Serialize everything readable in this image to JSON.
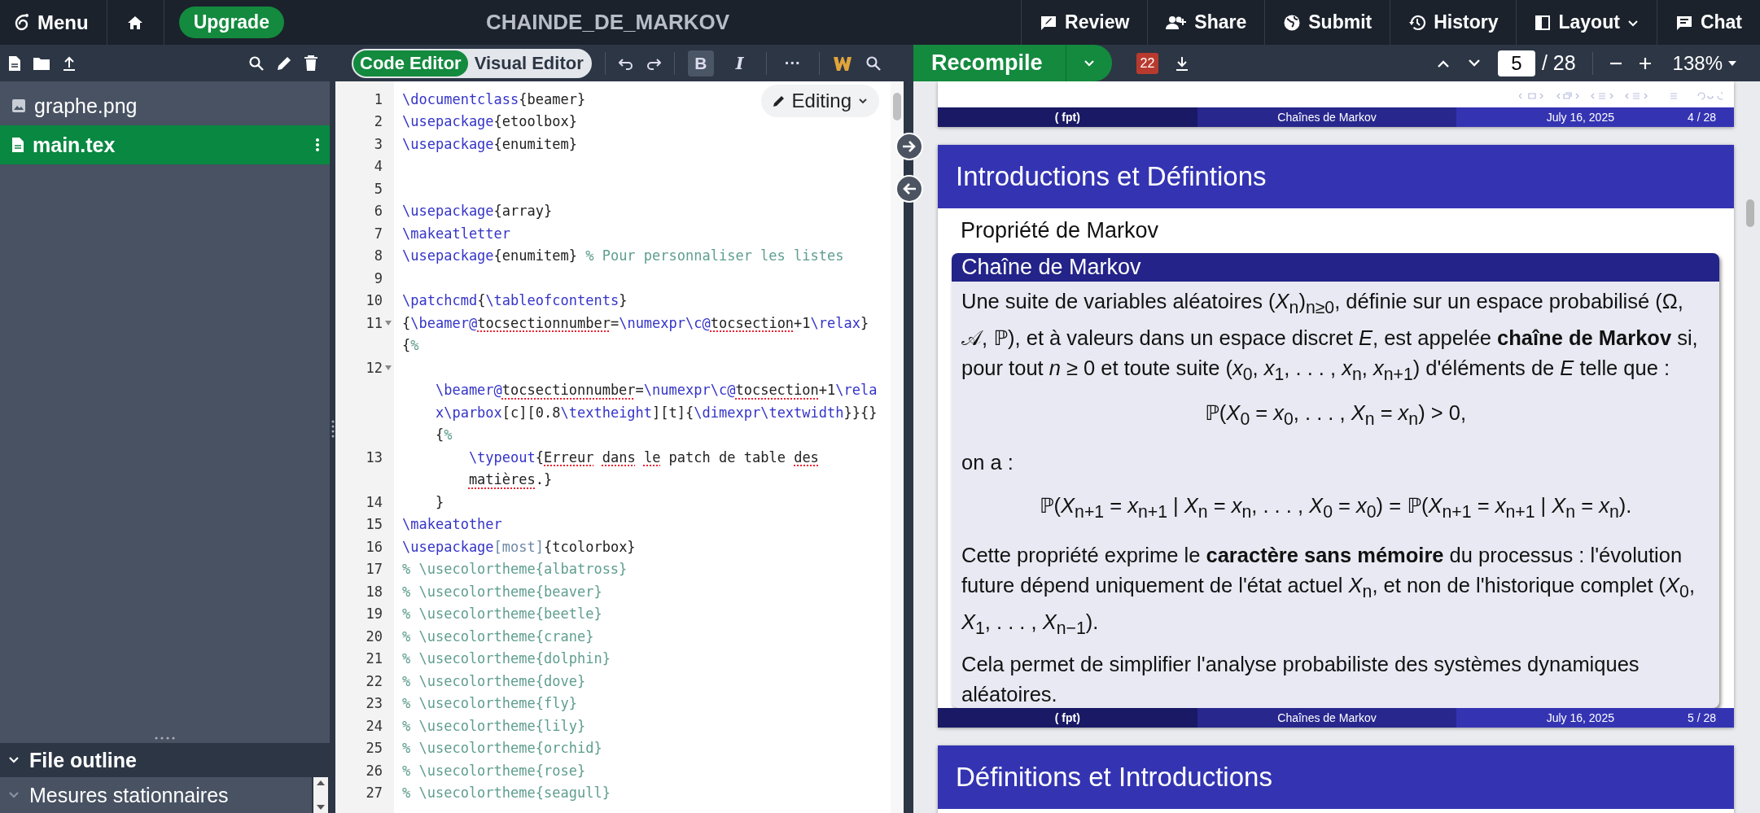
{
  "top_bar": {
    "menu_label": "Menu",
    "upgrade_label": "Upgrade",
    "title": "CHAINDE_DE_MARKOV",
    "actions": [
      {
        "kind": "review",
        "label": "Review"
      },
      {
        "kind": "share",
        "label": "Share"
      },
      {
        "kind": "submit",
        "label": "Submit"
      },
      {
        "kind": "history",
        "label": "History"
      },
      {
        "kind": "layout",
        "label": "Layout"
      },
      {
        "kind": "chat",
        "label": "Chat"
      }
    ]
  },
  "file_tree": {
    "files": [
      {
        "kind": "image",
        "name": "graphe.png",
        "selected": false
      },
      {
        "kind": "tex",
        "name": "main.tex",
        "selected": true
      }
    ]
  },
  "file_outline": {
    "title": "File outline",
    "expanded": true,
    "items": [
      {
        "label": "Mesures stationnaires"
      }
    ]
  },
  "editor_toolbar": {
    "modes": [
      {
        "label": "Code Editor",
        "selected": true
      },
      {
        "label": "Visual Editor",
        "selected": false
      }
    ],
    "format_buttons": [
      {
        "kind": "bold",
        "label": "B",
        "active": true
      },
      {
        "kind": "italic",
        "label": "I",
        "active": false
      }
    ],
    "more_label": "···"
  },
  "editing_menu": {
    "label": "Editing"
  },
  "code_lines": [
    {
      "number": "1",
      "segments": [
        {
          "kind": "command",
          "text": "\\documentclass"
        },
        {
          "kind": "text",
          "text": "{beamer}"
        }
      ]
    },
    {
      "number": "2",
      "segments": [
        {
          "kind": "command",
          "text": "\\usepackage"
        },
        {
          "kind": "text",
          "text": "{etoolbox}"
        }
      ]
    },
    {
      "number": "3",
      "segments": [
        {
          "kind": "command",
          "text": "\\usepackage"
        },
        {
          "kind": "text",
          "text": "{enumitem}"
        }
      ]
    },
    {
      "number": "4"
    },
    {
      "number": "5"
    },
    {
      "number": "6",
      "segments": [
        {
          "kind": "command",
          "text": "\\usepackage"
        },
        {
          "kind": "text",
          "text": "{array}"
        }
      ]
    },
    {
      "number": "7",
      "segments": [
        {
          "kind": "command",
          "text": "\\makeatletter"
        }
      ]
    },
    {
      "number": "8",
      "segments": [
        {
          "kind": "command",
          "text": "\\usepackage"
        },
        {
          "kind": "text",
          "text": "{enumitem} "
        },
        {
          "kind": "comment",
          "text": "% Pour personnaliser les listes"
        }
      ]
    },
    {
      "number": "9"
    },
    {
      "number": "10",
      "segments": [
        {
          "kind": "command",
          "text": "\\patchcmd"
        },
        {
          "kind": "text",
          "text": "{"
        },
        {
          "kind": "command",
          "text": "\\tableofcontents"
        },
        {
          "kind": "text",
          "text": "}"
        }
      ]
    },
    {
      "number": "11",
      "fold": true,
      "segments": [
        {
          "kind": "text",
          "text": "{"
        },
        {
          "kind": "command",
          "text": "\\beamer@"
        },
        {
          "kind": "typo",
          "text": "tocsectionnumber"
        },
        {
          "kind": "text",
          "text": "="
        },
        {
          "kind": "command",
          "text": "\\numexpr\\c@"
        },
        {
          "kind": "typo",
          "text": "tocsection"
        },
        {
          "kind": "text",
          "text": "+1"
        },
        {
          "kind": "command",
          "text": "\\relax"
        },
        {
          "kind": "text",
          "text": "}"
        }
      ]
    },
    {
      "segments": [
        {
          "kind": "text",
          "text": "{"
        },
        {
          "kind": "comment",
          "text": "%"
        }
      ]
    },
    {
      "number": "12",
      "fold": true,
      "children": [
        {
          "segments": [
            {
              "kind": "command",
              "text": "\\beamer@"
            },
            {
              "kind": "typo",
              "text": "tocsectionnumber"
            },
            {
              "kind": "text",
              "text": "="
            },
            {
              "kind": "command",
              "text": "\\numexpr\\c@"
            },
            {
              "kind": "typo",
              "text": "tocsection"
            },
            {
              "kind": "text",
              "text": "+1"
            },
            {
              "kind": "command",
              "text": "\\rela"
            }
          ]
        },
        {
          "segments": [
            {
              "kind": "command",
              "text": "x\\parbox"
            },
            {
              "kind": "text",
              "text": "[c][0.8"
            },
            {
              "kind": "command",
              "text": "\\textheight"
            },
            {
              "kind": "text",
              "text": "][t]{"
            },
            {
              "kind": "command",
              "text": "\\dimexpr"
            },
            {
              "kind": "command",
              "text": "\\textwidth"
            },
            {
              "kind": "text",
              "text": "}}{}"
            }
          ]
        },
        {
          "segments": [
            {
              "kind": "text",
              "text": "{"
            },
            {
              "kind": "comment",
              "text": "%"
            }
          ],
          "children": [
            {
              "number": "13",
              "segments": [
                {
                  "kind": "command",
                  "text": "\\typeout"
                },
                {
                  "kind": "text",
                  "text": "{"
                },
                {
                  "kind": "typo",
                  "text": "Erreur dans le"
                },
                {
                  "kind": "text",
                  "text": " patch de table "
                },
                {
                  "kind": "typo",
                  "text": "des"
                }
              ]
            },
            {
              "segments": [
                {
                  "kind": "typo",
                  "text": "matières"
                },
                {
                  "kind": "text",
                  "text": ".}"
                }
              ]
            }
          ]
        },
        {
          "number": "14",
          "segments": [
            {
              "kind": "text",
              "text": "}"
            }
          ]
        }
      ]
    },
    {
      "number": "15",
      "segments": [
        {
          "kind": "command",
          "text": "\\makeatother"
        }
      ]
    },
    {
      "number": "16",
      "segments": [
        {
          "kind": "command",
          "text": "\\usepackage"
        },
        {
          "kind": "option",
          "text": "[most]"
        },
        {
          "kind": "text",
          "text": "{tcolorbox}"
        }
      ]
    },
    {
      "number": "17",
      "segments": [
        {
          "kind": "comment",
          "text": "% \\usecolortheme{albatross}"
        }
      ]
    },
    {
      "number": "18",
      "segments": [
        {
          "kind": "comment",
          "text": "% \\usecolortheme{beaver}"
        }
      ]
    },
    {
      "number": "19",
      "segments": [
        {
          "kind": "comment",
          "text": "% \\usecolortheme{beetle}"
        }
      ]
    },
    {
      "number": "20",
      "segments": [
        {
          "kind": "comment",
          "text": "% \\usecolortheme{crane}"
        }
      ]
    },
    {
      "number": "21",
      "segments": [
        {
          "kind": "comment",
          "text": "% \\usecolortheme{dolphin}"
        }
      ]
    },
    {
      "number": "22",
      "segments": [
        {
          "kind": "comment",
          "text": "% \\usecolortheme{dove}"
        }
      ]
    },
    {
      "number": "23",
      "segments": [
        {
          "kind": "comment",
          "text": "% \\usecolortheme{fly}"
        }
      ]
    },
    {
      "number": "24",
      "segments": [
        {
          "kind": "comment",
          "text": "% \\usecolortheme{lily}"
        }
      ]
    },
    {
      "number": "25",
      "segments": [
        {
          "kind": "comment",
          "text": "% \\usecolortheme{orchid}"
        }
      ]
    },
    {
      "number": "26",
      "segments": [
        {
          "kind": "comment",
          "text": "% \\usecolortheme{rose}"
        }
      ]
    },
    {
      "number": "27",
      "segments": [
        {
          "kind": "comment",
          "text": "% \\usecolortheme{seagull}"
        }
      ]
    }
  ],
  "pdf_toolbar": {
    "recompile_label": "Recompile",
    "error_count": "22",
    "page": "5",
    "page_total": "/ 28",
    "zoom": "138%"
  },
  "pdf_pages": [
    {
      "kind": "page_end",
      "footline": {
        "author": "( fpt)",
        "title": "Chaînes de  Markov",
        "date": "July 16, 2025",
        "page": "4 / 28"
      }
    },
    {
      "kind": "full",
      "frame_title": "Introductions et Défintions",
      "subtitle": "Propriété de Markov",
      "block": {
        "title": "Chaîne de Markov",
        "content": [
          {
            "kind": "paragraph",
            "text": "Une suite de variables aléatoires (*X*$_{n}$)$_{n≥0}$, définie sur un espace probabilisé (Ω, 𝒜, ℙ), et à valeurs dans un espace discret *E*, est appelée **chaîne de Markov** si, pour tout *n* ≥ 0 et toute suite (*x*$_{0}$, *x*$_{1}$, . . . , *x*$_{n}$, *x*$_{n+1}$) d'éléments de *E* telle que :"
          },
          {
            "kind": "equation",
            "text": "ℙ(*X*$_{0}$ = *x*$_{0}$, . . . , *X*$_{n}$ = *x*$_{n}$) > 0,"
          },
          {
            "kind": "paragraph",
            "text": "on a :"
          },
          {
            "kind": "equation",
            "text": "ℙ(*X*$_{n+1}$ = *x*$_{n+1}$ | *X*$_{n}$ = *x*$_{n}$, . . . , *X*$_{0}$ = *x*$_{0}$) = ℙ(*X*$_{n+1}$ = *x*$_{n+1}$ | *X*$_{n}$ = *x*$_{n}$)."
          },
          {
            "kind": "paragraph",
            "text": "Cette propriété exprime le **caractère sans mémoire** du processus : l'évolution future dépend uniquement de l'état actuel *X*$_{n}$, et non de l'historique complet (*X*$_{0}$, *X*$_{1}$, . . . , *X*$_{n−1}$)."
          },
          {
            "kind": "paragraph",
            "text": "Cela permet de simplifier l'analyse probabiliste des systèmes dynamiques aléatoires."
          }
        ]
      },
      "footline": {
        "author": "( fpt)",
        "title": "Chaînes de  Markov",
        "date": "July 16, 2025",
        "page": "5 / 28"
      }
    },
    {
      "kind": "page_start",
      "frame_title": "Définitions et Introductions"
    }
  ]
}
